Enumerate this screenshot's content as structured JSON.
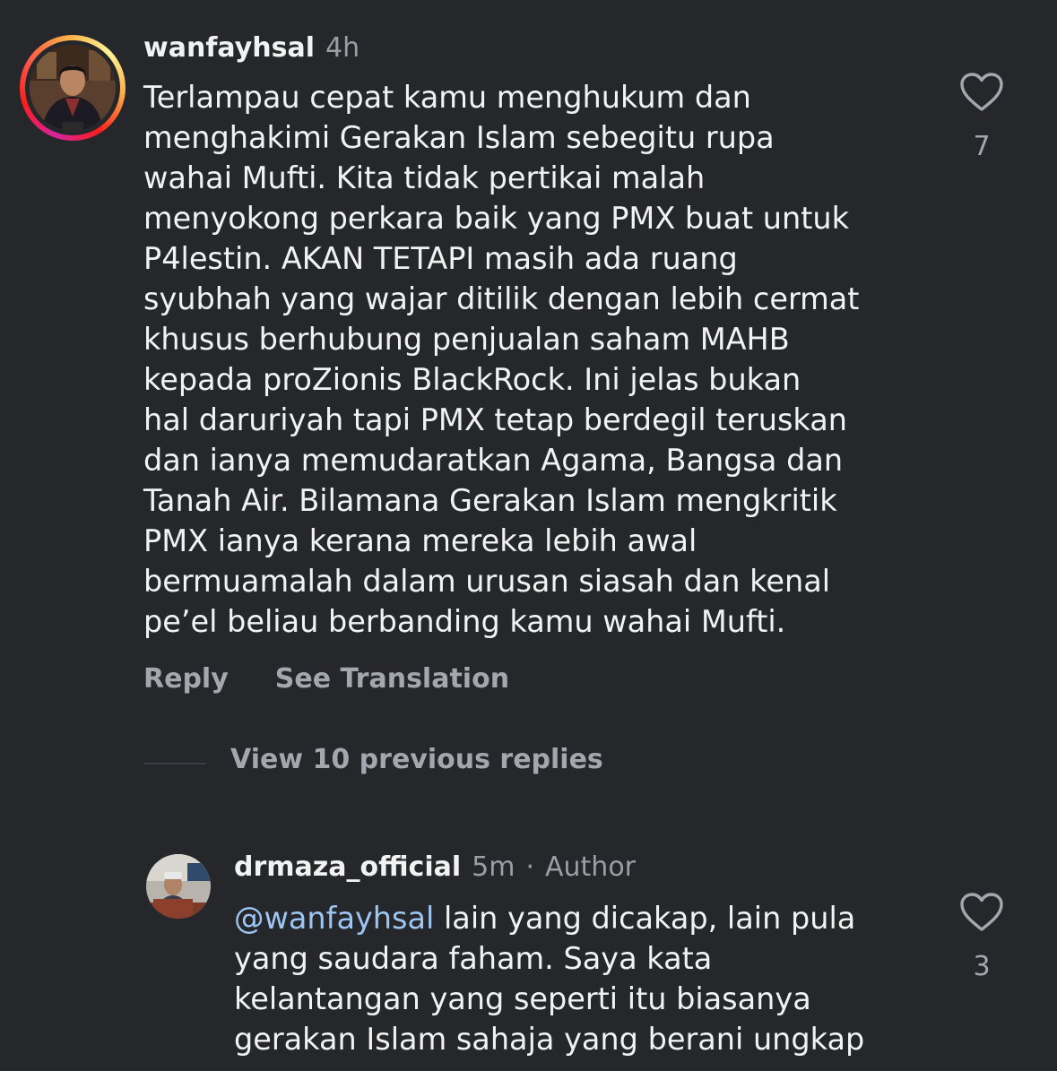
{
  "comment": {
    "username": "wanfayhsal",
    "time": "4h",
    "lines": [
      "Terlampau cepat kamu menghukum dan",
      "menghakimi Gerakan Islam sebegitu rupa",
      "wahai  Mufti. Kita tidak pertikai malah",
      "menyokong perkara baik yang PMX buat untuk",
      "P4lestin. AKAN TETAPI masih ada ruang",
      "syubhah yang wajar ditilik dengan lebih cermat",
      "khusus berhubung penjualan saham MAHB",
      "kepada proZionis BlackRock. Ini jelas bukan",
      "hal daruriyah tapi PMX tetap berdegil teruskan",
      "dan ianya memudaratkan Agama, Bangsa dan",
      "Tanah Air. Bilamana Gerakan Islam mengkritik",
      "PMX ianya kerana mereka lebih awal",
      "bermuamalah dalam urusan siasah dan kenal",
      "pe’el beliau berbanding kamu wahai Mufti."
    ],
    "reply_label": "Reply",
    "translate_label": "See Translation",
    "like_icon": "heart-outline-icon",
    "like_count": "7"
  },
  "view_replies_label": "View 10 previous replies",
  "reply": {
    "username": "drmaza_official",
    "time": "5m",
    "separator": "·",
    "badge": "Author",
    "mention": "@wanfayhsal",
    "first_line_rest": " lain yang dicakap, lain pula",
    "lines": [
      "yang saudara faham. Saya kata",
      "kelantangan yang seperti itu biasanya",
      "gerakan Islam sahaja yang berani ungkap"
    ],
    "like_icon": "heart-outline-icon",
    "like_count": "3"
  },
  "colors": {
    "background": "#25272b",
    "text": "#f2f2f2",
    "secondary": "#a3a7ae",
    "mention": "#9dc6f2",
    "story_ring": [
      "#d6249f",
      "#fd1d1d",
      "#fcaf45"
    ]
  }
}
